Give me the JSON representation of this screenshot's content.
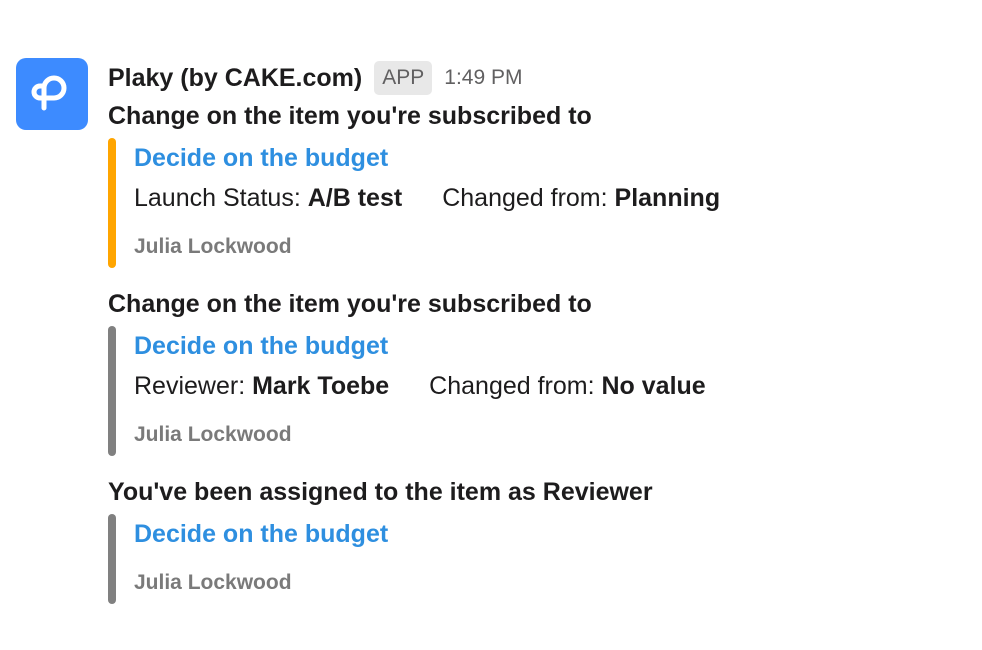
{
  "message": {
    "sender": "Plaky (by CAKE.com)",
    "badge": "APP",
    "time": "1:49 PM",
    "avatar_color": "#3d8bff",
    "avatar_icon": "plaky-logo-icon"
  },
  "blocks": [
    {
      "heading": "Change on the item you're subscribed to",
      "bar_color": "#ffa500",
      "title": "Decide on the budget",
      "field_label": "Launch Status: ",
      "field_value": "A/B test",
      "changed_label": "Changed from: ",
      "changed_value": "Planning",
      "author": "Julia Lockwood"
    },
    {
      "heading": "Change on the item you're subscribed to",
      "bar_color": "#808080",
      "title": "Decide on the budget",
      "field_label": "Reviewer: ",
      "field_value": "Mark Toebe",
      "changed_label": "Changed from: ",
      "changed_value": "No value",
      "author": "Julia Lockwood"
    },
    {
      "heading": "You've been assigned to the item as Reviewer",
      "bar_color": "#808080",
      "title": "Decide on the budget",
      "author": "Julia Lockwood"
    }
  ]
}
